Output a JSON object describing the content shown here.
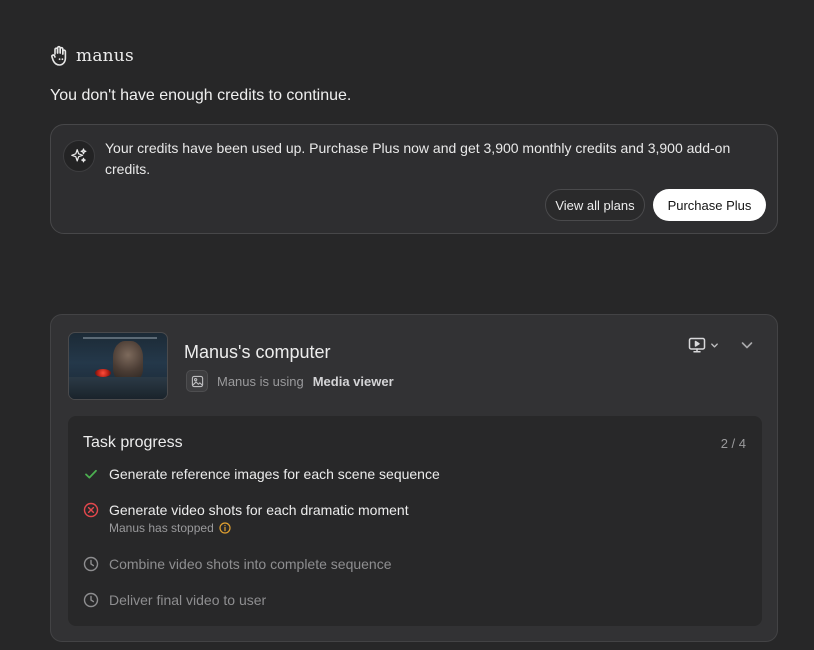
{
  "brand": {
    "name": "manus",
    "icon": "manus-hand-icon"
  },
  "notice": {
    "message": "You don't have enough credits to continue."
  },
  "credits_card": {
    "icon": "sparkle-icon",
    "text": "Your credits have been used up. Purchase Plus now and get 3,900 monthly credits and 3,900 add-on credits.",
    "view_plans_label": "View all plans",
    "purchase_label": "Purchase Plus"
  },
  "computer": {
    "title": "Manus's computer",
    "using_prefix": "Manus is using",
    "tool_name": "Media viewer",
    "tool_icon": "media-viewer-icon",
    "screen_icon": "screen-play-icon",
    "collapse_icon": "chevron-down-icon"
  },
  "task_progress": {
    "title": "Task progress",
    "count": "2 / 4",
    "items": [
      {
        "label": "Generate reference images for each scene sequence",
        "status": "done",
        "icon": "check-icon"
      },
      {
        "label": "Generate video shots for each dramatic moment",
        "status": "failed",
        "icon": "error-circle-icon",
        "sub": "Manus has stopped",
        "sub_icon": "info-icon"
      },
      {
        "label": "Combine video shots into complete sequence",
        "status": "pending",
        "icon": "clock-icon"
      },
      {
        "label": "Deliver final video to user",
        "status": "pending",
        "icon": "clock-icon"
      }
    ]
  },
  "colors": {
    "background": "#272728",
    "card": "#2e2e30",
    "success": "#4caf50",
    "error": "#e5484d",
    "warning": "#e0a030",
    "primary_button": "#ffffff"
  }
}
